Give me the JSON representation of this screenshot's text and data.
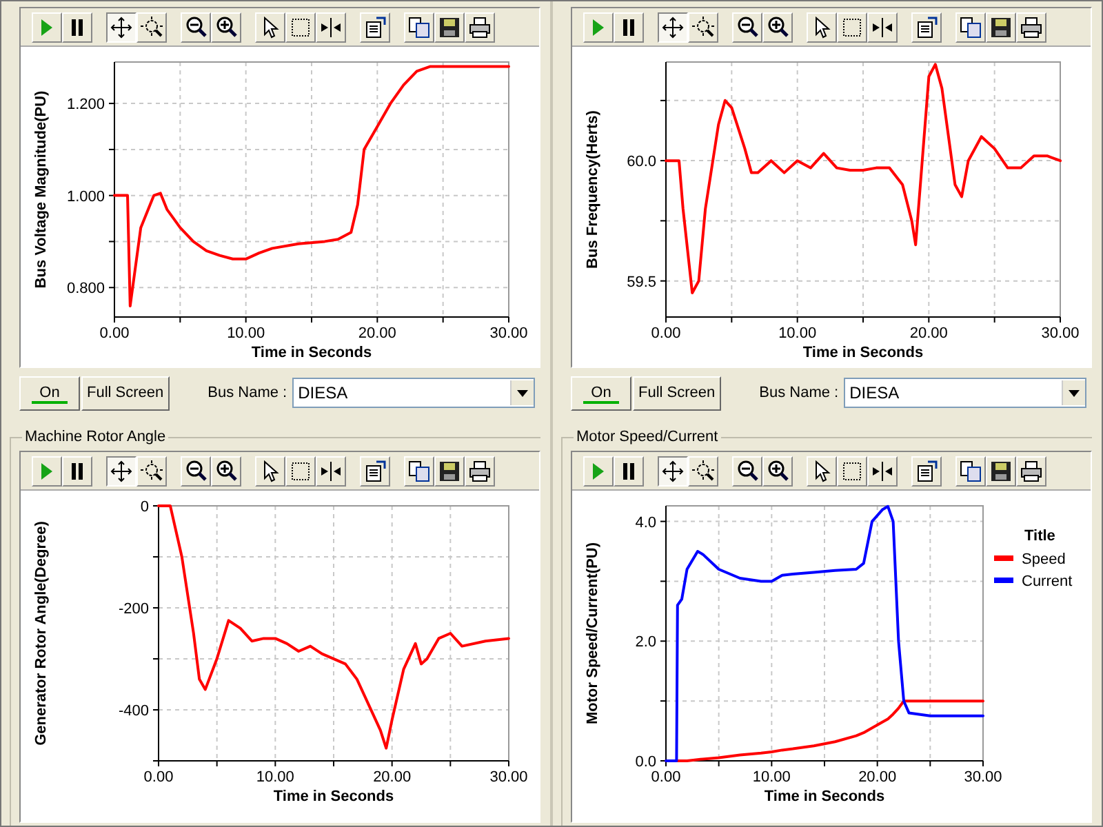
{
  "panels": [
    {
      "kind": "controls",
      "toolbar": [
        {
          "kind": "play",
          "selected": false
        },
        {
          "kind": "pause",
          "selected": false
        },
        {
          "kind": "pan",
          "selected": true
        },
        {
          "kind": "zoom-fit",
          "selected": false
        },
        {
          "kind": "zoom-out",
          "selected": false
        },
        {
          "kind": "zoom-in",
          "selected": false
        },
        {
          "kind": "pointer",
          "selected": false
        },
        {
          "kind": "select",
          "selected": false
        },
        {
          "kind": "split",
          "selected": false
        },
        {
          "kind": "properties",
          "selected": false
        },
        {
          "kind": "copy",
          "selected": false
        },
        {
          "kind": "save",
          "selected": false
        },
        {
          "kind": "print",
          "selected": false
        }
      ],
      "chart_data": {
        "type": "line",
        "grid": true,
        "xlabel": "Time in Seconds",
        "ylabel": "Bus Voltage Magnitude(PU)",
        "x": [
          0,
          1,
          1.2,
          2,
          3,
          3.5,
          4,
          5,
          6,
          7,
          8,
          9,
          10,
          11,
          12,
          14,
          16,
          17,
          18,
          18.5,
          19,
          20,
          21,
          22,
          23,
          24,
          30
        ],
        "series": [
          {
            "color": "#ff0000",
            "values": [
              1.0,
              1.0,
              0.76,
              0.93,
              1.0,
              1.005,
              0.97,
              0.93,
              0.9,
              0.88,
              0.87,
              0.862,
              0.862,
              0.875,
              0.885,
              0.895,
              0.9,
              0.905,
              0.92,
              0.98,
              1.1,
              1.15,
              1.2,
              1.24,
              1.27,
              1.28,
              1.28
            ]
          }
        ],
        "xlim": [
          0,
          30
        ],
        "ylim": [
          0.736,
          1.29
        ],
        "xticks": [
          {
            "value": 0,
            "label": "0.00"
          },
          {
            "value": 10,
            "label": "10.00"
          },
          {
            "value": 20,
            "label": "20.00"
          },
          {
            "value": 30,
            "label": "30.00"
          }
        ],
        "yticks": [
          {
            "value": 0.8,
            "label": "0.800"
          },
          {
            "value": 1.0,
            "label": "1.000"
          },
          {
            "value": 1.2,
            "label": "1.200"
          }
        ]
      },
      "on_button": {
        "label": "On",
        "on": true
      },
      "full_screen_button": "Full Screen",
      "bus_name_label": "Bus Name :",
      "bus_name_value": "DIESA"
    },
    {
      "kind": "controls",
      "toolbar": [
        {
          "kind": "play",
          "selected": false
        },
        {
          "kind": "pause",
          "selected": false
        },
        {
          "kind": "pan",
          "selected": true
        },
        {
          "kind": "zoom-fit",
          "selected": false
        },
        {
          "kind": "zoom-out",
          "selected": false
        },
        {
          "kind": "zoom-in",
          "selected": false
        },
        {
          "kind": "pointer",
          "selected": false
        },
        {
          "kind": "select",
          "selected": false
        },
        {
          "kind": "split",
          "selected": false
        },
        {
          "kind": "properties",
          "selected": false
        },
        {
          "kind": "copy",
          "selected": false
        },
        {
          "kind": "save",
          "selected": false
        },
        {
          "kind": "print",
          "selected": false
        }
      ],
      "chart_data": {
        "type": "line",
        "grid": true,
        "xlabel": "Time in Seconds",
        "ylabel": "Bus Frequency(Herts)",
        "x": [
          0,
          1,
          1.3,
          2,
          2.5,
          3,
          4,
          4.5,
          5,
          6,
          6.5,
          7,
          8,
          9,
          10,
          11,
          12,
          13,
          14,
          15,
          16,
          17,
          18,
          18.7,
          19,
          19.5,
          20,
          20.5,
          21,
          22,
          22.5,
          23,
          24,
          25,
          26,
          27,
          28,
          29,
          30
        ],
        "series": [
          {
            "color": "#ff0000",
            "values": [
              60.0,
              60.0,
              59.8,
              59.45,
              59.5,
              59.8,
              60.15,
              60.25,
              60.22,
              60.05,
              59.95,
              59.95,
              60.0,
              59.95,
              60.0,
              59.97,
              60.03,
              59.97,
              59.96,
              59.96,
              59.97,
              59.97,
              59.9,
              59.75,
              59.65,
              60.0,
              60.35,
              60.4,
              60.3,
              59.9,
              59.85,
              60.0,
              60.1,
              60.05,
              59.97,
              59.97,
              60.02,
              60.02,
              60.0
            ]
          }
        ],
        "xlim": [
          0,
          30
        ],
        "ylim": [
          59.35,
          60.41
        ],
        "xticks": [
          {
            "value": 0,
            "label": "0.00"
          },
          {
            "value": 10,
            "label": "10.00"
          },
          {
            "value": 20,
            "label": "20.00"
          },
          {
            "value": 30,
            "label": "30.00"
          }
        ],
        "yticks": [
          {
            "value": 59.5,
            "label": "59.5"
          },
          {
            "value": 60.0,
            "label": "60.0"
          }
        ]
      },
      "on_button": {
        "label": "On",
        "on": true
      },
      "full_screen_button": "Full Screen",
      "bus_name_label": "Bus Name :",
      "bus_name_value": "DIESA"
    },
    {
      "kind": "group",
      "title": "Machine Rotor Angle",
      "toolbar": [
        {
          "kind": "play",
          "selected": false
        },
        {
          "kind": "pause",
          "selected": false
        },
        {
          "kind": "pan",
          "selected": true
        },
        {
          "kind": "zoom-fit",
          "selected": false
        },
        {
          "kind": "zoom-out",
          "selected": false
        },
        {
          "kind": "zoom-in",
          "selected": false
        },
        {
          "kind": "pointer",
          "selected": false
        },
        {
          "kind": "select",
          "selected": false
        },
        {
          "kind": "split",
          "selected": false
        },
        {
          "kind": "properties",
          "selected": false
        },
        {
          "kind": "copy",
          "selected": false
        },
        {
          "kind": "save",
          "selected": false
        },
        {
          "kind": "print",
          "selected": false
        }
      ],
      "chart_data": {
        "type": "line",
        "grid": true,
        "xlabel": "Time in Seconds",
        "ylabel": "Generator Rotor Angle(Degree)",
        "x": [
          0,
          1,
          2,
          3,
          3.5,
          4,
          5,
          6,
          7,
          8,
          9,
          10,
          11,
          12,
          13,
          14,
          16,
          17,
          18,
          19,
          19.5,
          20,
          21,
          22,
          22.5,
          23,
          24,
          25,
          26,
          28,
          30
        ],
        "series": [
          {
            "color": "#ff0000",
            "values": [
              0,
              0,
              -100,
              -250,
              -340,
              -360,
              -300,
              -225,
              -240,
              -265,
              -260,
              -260,
              -270,
              -285,
              -275,
              -290,
              -310,
              -340,
              -390,
              -440,
              -475,
              -420,
              -320,
              -270,
              -310,
              -300,
              -260,
              -250,
              -275,
              -265,
              -260
            ]
          }
        ],
        "xlim": [
          0,
          30
        ],
        "ylim": [
          -500,
          0
        ],
        "xticks": [
          {
            "value": 0,
            "label": "0.00"
          },
          {
            "value": 10,
            "label": "10.00"
          },
          {
            "value": 20,
            "label": "20.00"
          },
          {
            "value": 30,
            "label": "30.00"
          }
        ],
        "yticks": [
          {
            "value": 0,
            "label": "0"
          },
          {
            "value": -200,
            "label": "-200"
          },
          {
            "value": -400,
            "label": "-400"
          }
        ]
      }
    },
    {
      "kind": "group",
      "title": "Motor Speed/Current",
      "toolbar": [
        {
          "kind": "play",
          "selected": false
        },
        {
          "kind": "pause",
          "selected": false
        },
        {
          "kind": "pan",
          "selected": true
        },
        {
          "kind": "zoom-fit",
          "selected": false
        },
        {
          "kind": "zoom-out",
          "selected": false
        },
        {
          "kind": "zoom-in",
          "selected": false
        },
        {
          "kind": "pointer",
          "selected": false
        },
        {
          "kind": "select",
          "selected": false
        },
        {
          "kind": "split",
          "selected": false
        },
        {
          "kind": "properties",
          "selected": false
        },
        {
          "kind": "copy",
          "selected": false
        },
        {
          "kind": "save",
          "selected": false
        },
        {
          "kind": "print",
          "selected": false
        }
      ],
      "chart_data": {
        "type": "line",
        "grid": true,
        "legend": {
          "title": "Title"
        },
        "xlabel": "Time in Seconds",
        "ylabel": "Motor Speed/Current(PU)",
        "x": [
          0,
          1,
          1.1,
          1.5,
          2,
          3,
          3.5,
          5,
          7,
          9,
          10,
          11,
          12,
          14,
          16,
          18,
          18.7,
          19.5,
          20.5,
          21,
          21.5,
          22,
          22.5,
          23,
          25,
          30
        ],
        "series": [
          {
            "name": "Speed",
            "color": "#ff0000",
            "values": [
              0,
              0,
              0,
              0,
              0,
              0.02,
              0.03,
              0.05,
              0.1,
              0.13,
              0.15,
              0.18,
              0.2,
              0.25,
              0.32,
              0.42,
              0.47,
              0.55,
              0.65,
              0.7,
              0.78,
              0.88,
              1.0,
              1.0,
              1.0,
              1.0
            ]
          },
          {
            "name": "Current",
            "color": "#0000ff",
            "values": [
              0,
              0,
              2.6,
              2.7,
              3.2,
              3.5,
              3.45,
              3.2,
              3.05,
              3.0,
              3.0,
              3.1,
              3.12,
              3.15,
              3.18,
              3.2,
              3.3,
              4.0,
              4.2,
              4.25,
              4.0,
              2.0,
              1.0,
              0.8,
              0.75,
              0.75
            ]
          }
        ],
        "xlim": [
          0,
          30
        ],
        "ylim": [
          0,
          4.26
        ],
        "xticks": [
          {
            "value": 0,
            "label": "0.00"
          },
          {
            "value": 10,
            "label": "10.00"
          },
          {
            "value": 20,
            "label": "20.00"
          },
          {
            "value": 30,
            "label": "30.00"
          }
        ],
        "yticks": [
          {
            "value": 0,
            "label": "0.0"
          },
          {
            "value": 2,
            "label": "2.0"
          },
          {
            "value": 4,
            "label": "4.0"
          }
        ]
      }
    }
  ]
}
